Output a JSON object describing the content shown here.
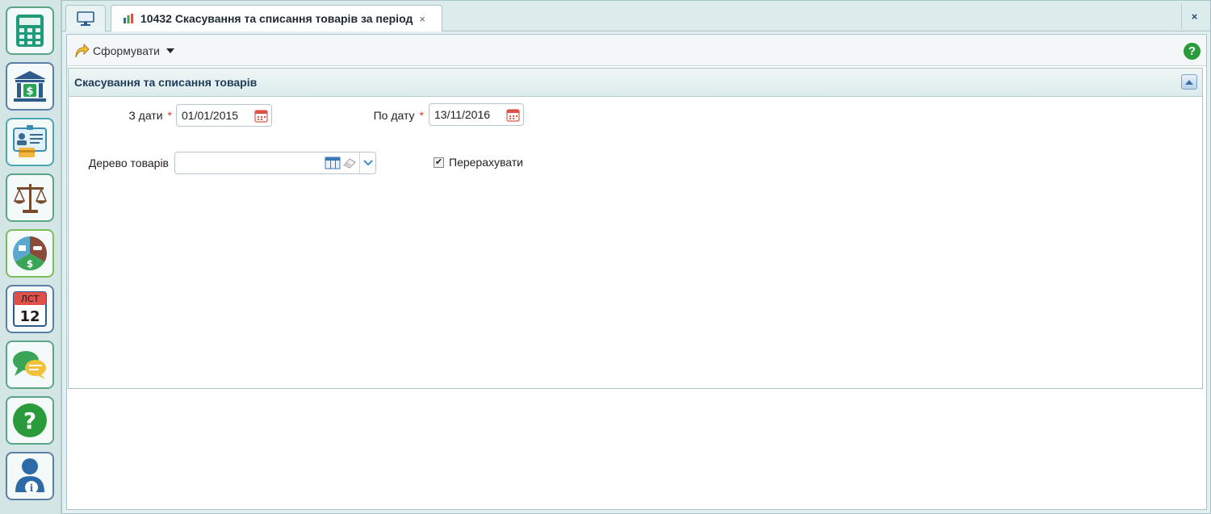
{
  "tabs": {
    "home_icon": "monitor-icon",
    "report": {
      "icon": "bar-chart-icon",
      "title": "10432 Скасування та списання товарів за період",
      "close": "×"
    },
    "window_close": "×"
  },
  "toolbar": {
    "generate_label": "Сформувати",
    "help": "?"
  },
  "panel": {
    "title": "Скасування та списання товарів"
  },
  "form": {
    "from_date": {
      "label": "З дати",
      "required": "*",
      "value": "01/01/2015"
    },
    "to_date": {
      "label": "По дату",
      "required": "*",
      "value": "13/11/2016"
    },
    "goods_tree": {
      "label": "Дерево товарів",
      "value": ""
    },
    "recalculate": {
      "label": "Перерахувати",
      "checked": true,
      "mark": "✔"
    }
  },
  "launcher": {
    "items": [
      "calculator-icon",
      "bank-icon",
      "id-card-icon",
      "scales-icon",
      "budget-pie-icon",
      "calendar-icon",
      "chat-icon",
      "help-icon",
      "user-info-icon"
    ],
    "calendar_month": "ЛСТ",
    "calendar_day": "12",
    "help_glyph": "?",
    "info_glyph": "i"
  },
  "colors": {
    "accent_green": "#2b9a3a",
    "required": "#e03a2f",
    "calendar_red": "#e0504a"
  }
}
